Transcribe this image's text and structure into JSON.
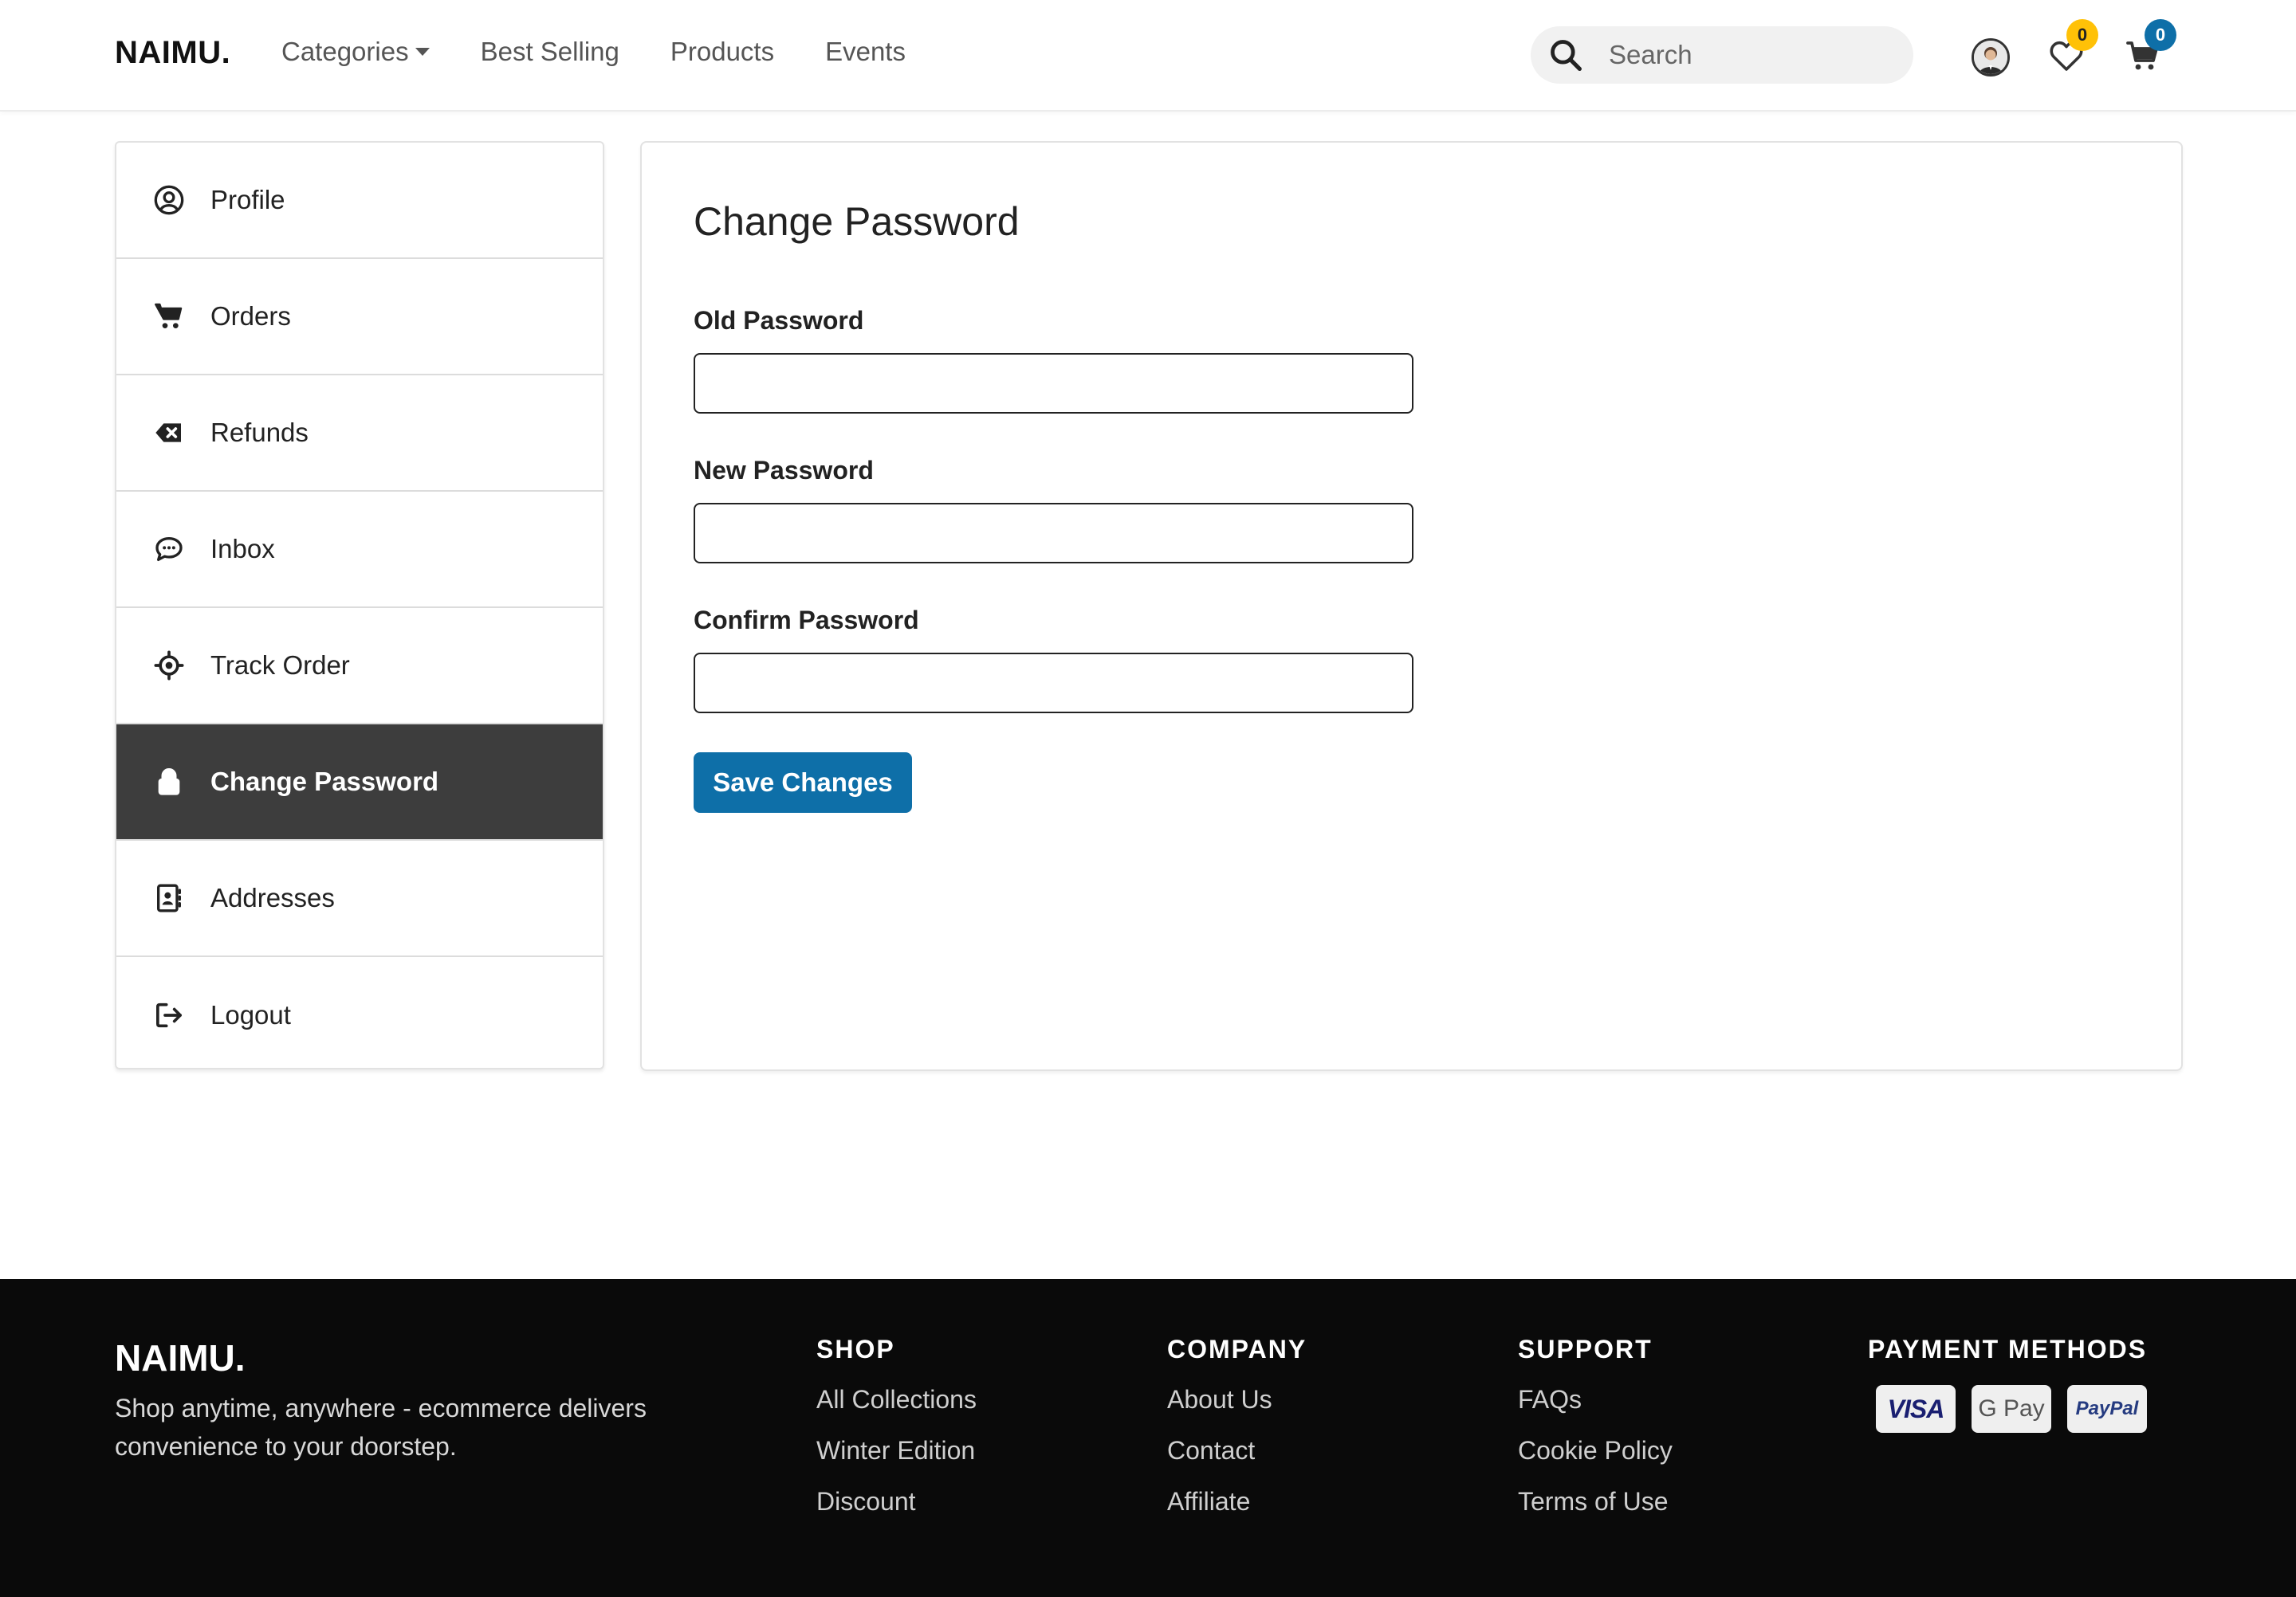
{
  "header": {
    "brand": "NAIMU.",
    "nav": [
      {
        "label": "Categories",
        "has_dropdown": true
      },
      {
        "label": "Best Selling"
      },
      {
        "label": "Products"
      },
      {
        "label": "Events"
      }
    ],
    "search_placeholder": "Search",
    "wishlist_count": "0",
    "cart_count": "0"
  },
  "sidebar": {
    "items": [
      {
        "label": "Profile",
        "icon": "user-circle-icon"
      },
      {
        "label": "Orders",
        "icon": "cart-icon"
      },
      {
        "label": "Refunds",
        "icon": "backspace-icon"
      },
      {
        "label": "Inbox",
        "icon": "chat-bubble-icon"
      },
      {
        "label": "Track Order",
        "icon": "crosshair-icon"
      },
      {
        "label": "Change Password",
        "icon": "lock-icon",
        "active": true
      },
      {
        "label": "Addresses",
        "icon": "address-book-icon"
      },
      {
        "label": "Logout",
        "icon": "logout-icon"
      }
    ]
  },
  "main": {
    "title": "Change Password",
    "fields": [
      {
        "label": "Old Password",
        "value": ""
      },
      {
        "label": "New Password",
        "value": ""
      },
      {
        "label": "Confirm Password",
        "value": ""
      }
    ],
    "save_label": "Save Changes"
  },
  "footer": {
    "brand": "NAIMU.",
    "tagline": "Shop anytime, anywhere - ecommerce delivers convenience to your doorstep.",
    "columns": [
      {
        "heading": "SHOP",
        "links": [
          "All Collections",
          "Winter Edition",
          "Discount"
        ]
      },
      {
        "heading": "COMPANY",
        "links": [
          "About Us",
          "Contact",
          "Affiliate"
        ]
      },
      {
        "heading": "SUPPORT",
        "links": [
          "FAQs",
          "Cookie Policy",
          "Terms of Use"
        ]
      }
    ],
    "payment_heading": "PAYMENT METHODS",
    "payment_methods": [
      "VISA",
      "G Pay",
      "PayPal"
    ]
  },
  "colors": {
    "accent": "#0e6fa8",
    "active_sidebar": "#3d3d3d",
    "wishlist_badge": "#ffc107",
    "footer_bg": "#0a0a0a"
  }
}
